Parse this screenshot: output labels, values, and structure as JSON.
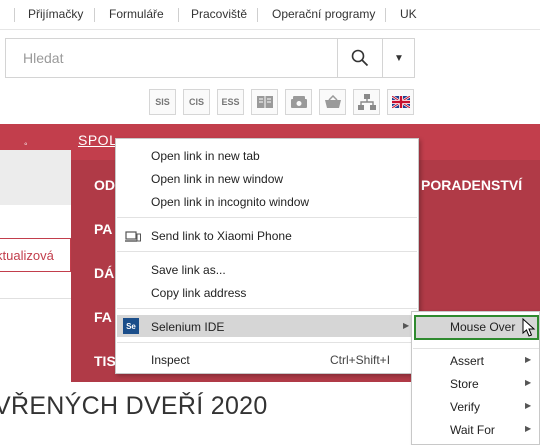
{
  "topnav": {
    "items": [
      "Přijímačky",
      "Formuláře",
      "Pracoviště",
      "Operační programy",
      "UK"
    ]
  },
  "search": {
    "placeholder": "Hledat",
    "dropdown_icon": "chevron-down-icon"
  },
  "quick_icons": [
    {
      "label": "SIS"
    },
    {
      "label": "CIS"
    },
    {
      "label": "ESS"
    },
    {
      "label": "",
      "icon": "book-icon"
    },
    {
      "label": "",
      "icon": "phone-icon"
    },
    {
      "label": "",
      "icon": "basket-icon"
    },
    {
      "label": "",
      "icon": "sitemap-icon"
    },
    {
      "label": "",
      "icon": "uk-flag-icon"
    }
  ],
  "main_menu": {
    "top_left": "SPOL",
    "top_right": "...",
    "items": [
      "OD",
      "PA",
      "DÁ",
      "FA",
      "TIS"
    ],
    "right_item": "PORADENSTVÍ"
  },
  "left_panel": {
    "button_label": "ktualizová"
  },
  "page_heading": "VŘENÝCH DVEŘÍ 2020",
  "context_menu": {
    "items": [
      {
        "label": "Open link in new tab"
      },
      {
        "label": "Open link in new window"
      },
      {
        "label": "Open link in incognito window"
      },
      {
        "label": "Send link to Xiaomi Phone"
      },
      {
        "label": "Save link as..."
      },
      {
        "label": "Copy link address"
      },
      {
        "label": "Selenium IDE"
      },
      {
        "label": "Inspect",
        "shortcut": "Ctrl+Shift+I"
      }
    ]
  },
  "selenium_submenu": {
    "items": [
      "Mouse Over",
      "Assert",
      "Store",
      "Verify",
      "Wait For"
    ]
  },
  "colors": {
    "menu_red": "#c23e4c",
    "highlight_green": "#2f8a2f"
  }
}
